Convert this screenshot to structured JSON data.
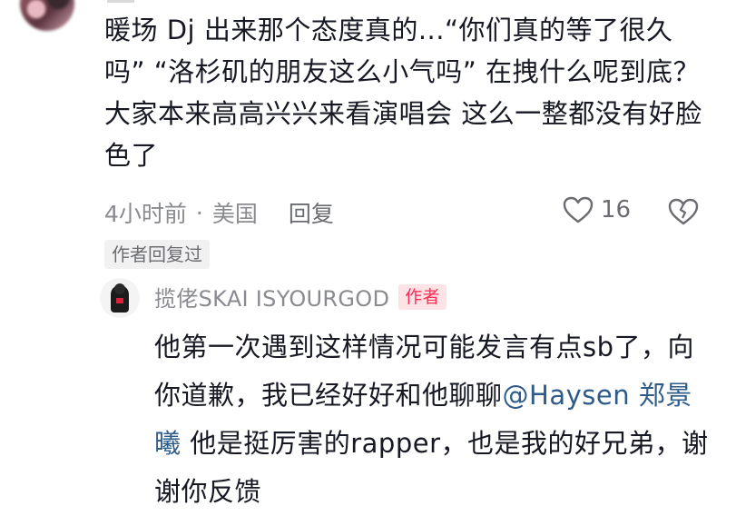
{
  "comment": {
    "text": "暖场 Dj 出来那个态度真的...“你们真的等了很久吗” “洛杉矶的朋友这么小气吗” 在拽什么呢到底？大家本来高高兴兴来看演唱会 这么一整都没有好脸色了",
    "time": "4小时前",
    "location": "美国",
    "reply_label": "回复",
    "like_count": "16"
  },
  "author_replied_label": "作者回复过",
  "reply": {
    "author": "揽佬SKAI ISYOURGOD",
    "author_badge": "作者",
    "text_before": "他第一次遇到这样情况可能发言有点sb了，向你道歉，我已经好好和他聊聊",
    "mention": "@Haysen 郑景曦",
    "text_after": " 他是挺厉害的rapper，也是我的好兄弟，谢谢你反馈"
  },
  "icons": {
    "like": "heart-icon",
    "dislike": "broken-heart-icon"
  },
  "colors": {
    "text": "#161823",
    "meta": "#8a8b91",
    "mention": "#2e5c8a",
    "author_badge": "#fe2c55"
  }
}
